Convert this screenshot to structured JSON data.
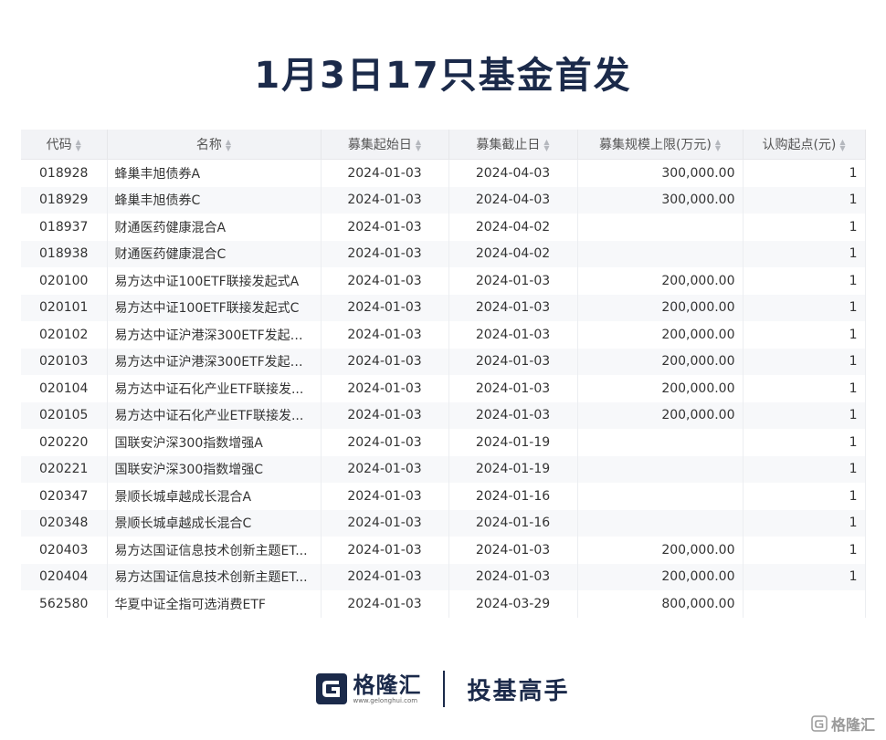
{
  "title": "1月3日17只基金首发",
  "table": {
    "headers": [
      "代码",
      "名称",
      "募集起始日",
      "募集截止日",
      "募集规模上限(万元)",
      "认购起点(元)"
    ],
    "rows": [
      [
        "018928",
        "蜂巢丰旭债券A",
        "2024-01-03",
        "2024-04-03",
        "300,000.00",
        "1"
      ],
      [
        "018929",
        "蜂巢丰旭债券C",
        "2024-01-03",
        "2024-04-03",
        "300,000.00",
        "1"
      ],
      [
        "018937",
        "财通医药健康混合A",
        "2024-01-03",
        "2024-04-02",
        "",
        "1"
      ],
      [
        "018938",
        "财通医药健康混合C",
        "2024-01-03",
        "2024-04-02",
        "",
        "1"
      ],
      [
        "020100",
        "易方达中证100ETF联接发起式A",
        "2024-01-03",
        "2024-01-03",
        "200,000.00",
        "1"
      ],
      [
        "020101",
        "易方达中证100ETF联接发起式C",
        "2024-01-03",
        "2024-01-03",
        "200,000.00",
        "1"
      ],
      [
        "020102",
        "易方达中证沪港深300ETF发起式...",
        "2024-01-03",
        "2024-01-03",
        "200,000.00",
        "1"
      ],
      [
        "020103",
        "易方达中证沪港深300ETF发起式...",
        "2024-01-03",
        "2024-01-03",
        "200,000.00",
        "1"
      ],
      [
        "020104",
        "易方达中证石化产业ETF联接发...",
        "2024-01-03",
        "2024-01-03",
        "200,000.00",
        "1"
      ],
      [
        "020105",
        "易方达中证石化产业ETF联接发...",
        "2024-01-03",
        "2024-01-03",
        "200,000.00",
        "1"
      ],
      [
        "020220",
        "国联安沪深300指数增强A",
        "2024-01-03",
        "2024-01-19",
        "",
        "1"
      ],
      [
        "020221",
        "国联安沪深300指数增强C",
        "2024-01-03",
        "2024-01-19",
        "",
        "1"
      ],
      [
        "020347",
        "景顺长城卓越成长混合A",
        "2024-01-03",
        "2024-01-16",
        "",
        "1"
      ],
      [
        "020348",
        "景顺长城卓越成长混合C",
        "2024-01-03",
        "2024-01-16",
        "",
        "1"
      ],
      [
        "020403",
        "易方达国证信息技术创新主题ET...",
        "2024-01-03",
        "2024-01-03",
        "200,000.00",
        "1"
      ],
      [
        "020404",
        "易方达国证信息技术创新主题ET...",
        "2024-01-03",
        "2024-01-03",
        "200,000.00",
        "1"
      ],
      [
        "562580",
        "华夏中证全指可选消费ETF",
        "2024-01-03",
        "2024-03-29",
        "800,000.00",
        ""
      ]
    ]
  },
  "footer": {
    "logo_name": "格隆汇",
    "logo_url": "www.gelonghui.com",
    "slogan": "投基高手"
  },
  "watermark": "格隆汇",
  "icons": {
    "sort": "sort-icon",
    "logo": "gelonghui-logo-icon",
    "watermark": "gelonghui-watermark-icon"
  },
  "colors": {
    "title": "#1b2a4a",
    "link": "#2c56a8",
    "header_bg": "#f2f3f6",
    "stripe_bg": "#f7f8fa"
  }
}
